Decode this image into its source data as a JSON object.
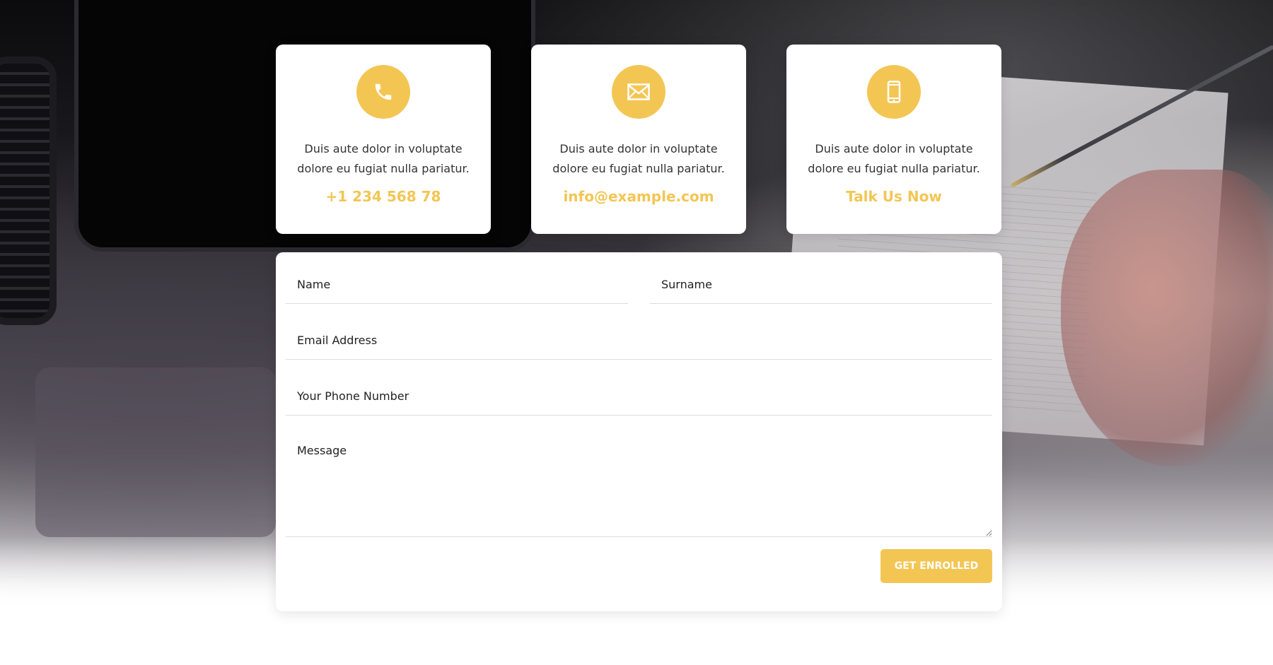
{
  "cards": [
    {
      "icon": "phone-icon",
      "text": "Duis aute dolor in voluptate dolore eu fugiat nulla pariatur.",
      "link": "+1 234 568 78"
    },
    {
      "icon": "envelope-icon",
      "text": "Duis aute dolor in voluptate dolore eu fugiat nulla pariatur.",
      "link": "info@example.com"
    },
    {
      "icon": "mobile-phone-icon",
      "text": "Duis aute dolor in voluptate dolore eu fugiat nulla pariatur.",
      "link": "Talk Us Now"
    }
  ],
  "form": {
    "name_placeholder": "Name",
    "surname_placeholder": "Surname",
    "email_placeholder": "Email Address",
    "phone_placeholder": "Your Phone Number",
    "message_placeholder": "Message",
    "submit_label": "GET ENROLLED"
  },
  "colors": {
    "accent": "#f3c654",
    "text": "#333333",
    "card_bg": "#ffffff"
  }
}
